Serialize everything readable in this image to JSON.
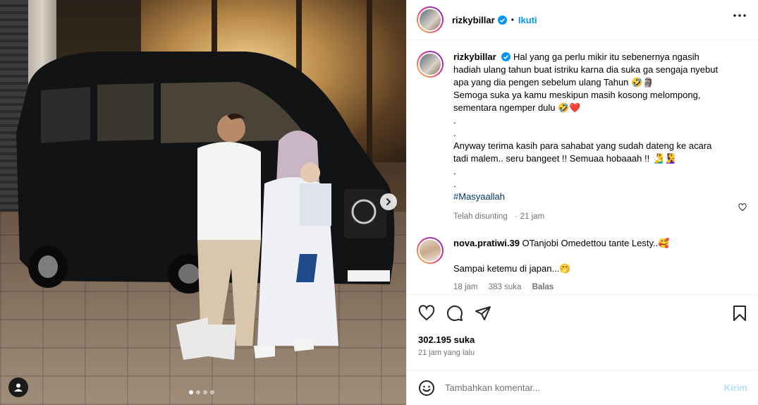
{
  "post": {
    "username": "rizkybillar",
    "follow_label": "Ikuti",
    "separator": "•"
  },
  "caption": {
    "username": "rizkybillar",
    "lines": [
      "Hal yang ga perlu mikir itu sebenernya ngasih",
      "hadiah ulang tahun buat istriku karna dia suka ga sengaja nyebut",
      "apa yang dia pengen sebelum ulang Tahun 🤣🗿",
      "Semoga suka ya kamu meskipun masih kosong melompong,",
      "sementara ngemper dulu 🤣❤️",
      ".",
      ".",
      "Anyway terima kasih para sahabat yang sudah dateng ke acara",
      "tadi malem.. seru bangeet !! Semuaa hobaaah !! 🧏‍♂️🧏‍♀️",
      ".",
      "."
    ],
    "hashtag": "#Masyaallah",
    "edited_label": "Telah disunting",
    "time_ago": "21 jam"
  },
  "comment": {
    "username": "nova.pratiwi.39",
    "text": "OTanjobi Omedettou tante Lesty..🥰",
    "text2": "Sampai ketemu di japan...🤭",
    "time_ago": "18 jam",
    "likes": "383 suka",
    "reply_label": "Balas"
  },
  "stats": {
    "likes": "302.195 suka",
    "posted": "21 jam yang lalu"
  },
  "add_comment": {
    "placeholder": "Tambahkan komentar...",
    "post_label": "Kirim"
  },
  "carousel": {
    "current": 1,
    "total": 4
  },
  "colors": {
    "accent": "#0095f6",
    "hashtag": "#00376b",
    "muted": "#737373"
  }
}
